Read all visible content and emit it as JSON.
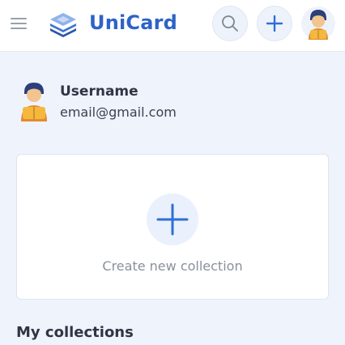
{
  "header": {
    "brand": "UniCard",
    "icons": {
      "menu": "hamburger-menu-icon",
      "logo": "stacked-cards-logo-icon",
      "search": "search-icon",
      "add": "plus-icon",
      "avatar": "user-avatar-icon"
    }
  },
  "profile": {
    "username": "Username",
    "email": "email@gmail.com"
  },
  "create": {
    "label": "Create new collection"
  },
  "collections": {
    "title": "My collections"
  },
  "colors": {
    "brand": "#2d63c8",
    "accent": "#2f6fd6",
    "background": "#eef3fc"
  }
}
